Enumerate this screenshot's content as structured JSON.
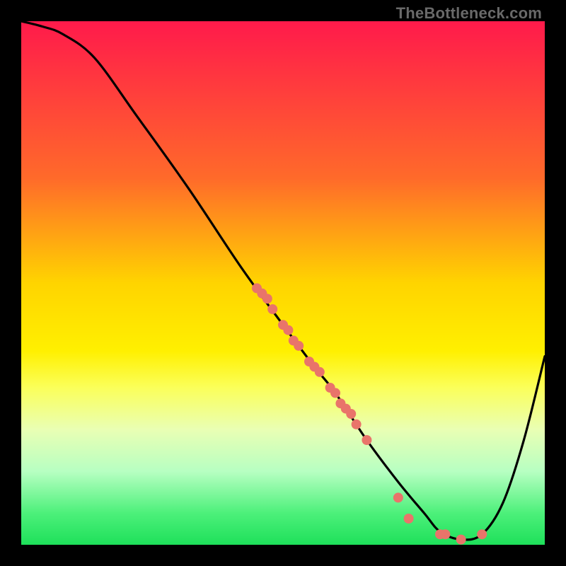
{
  "watermark": "TheBottleneck.com",
  "chart_data": {
    "type": "line",
    "title": "",
    "xlabel": "",
    "ylabel": "",
    "xlim": [
      0,
      100
    ],
    "ylim": [
      0,
      100
    ],
    "gradient": {
      "stops": [
        {
          "offset": 0.0,
          "color": "#ff1a4b"
        },
        {
          "offset": 0.3,
          "color": "#ff6a2a"
        },
        {
          "offset": 0.5,
          "color": "#ffd400"
        },
        {
          "offset": 0.63,
          "color": "#fff000"
        },
        {
          "offset": 0.7,
          "color": "#fbff5a"
        },
        {
          "offset": 0.78,
          "color": "#e9ffb4"
        },
        {
          "offset": 0.86,
          "color": "#b7ffc2"
        },
        {
          "offset": 0.94,
          "color": "#4cf07a"
        },
        {
          "offset": 1.0,
          "color": "#1ee05a"
        }
      ]
    },
    "series": [
      {
        "name": "curve",
        "x": [
          0,
          4,
          8,
          14,
          22,
          32,
          42,
          50,
          56,
          60,
          66,
          72,
          77,
          80,
          84,
          88,
          92,
          96,
          100
        ],
        "y": [
          100,
          99,
          97.5,
          93,
          82,
          68,
          53,
          42,
          34,
          29,
          20,
          12,
          6,
          2.5,
          1,
          2,
          8,
          20,
          36
        ]
      }
    ],
    "scatter": {
      "name": "points",
      "color": "#e9746a",
      "x": [
        45,
        46,
        47,
        48,
        50,
        51,
        52,
        53,
        55,
        56,
        57,
        59,
        60,
        61,
        62,
        63,
        64,
        66,
        72,
        74,
        80,
        81,
        84,
        88
      ],
      "y": [
        49,
        48,
        47,
        45,
        42,
        41,
        39,
        38,
        35,
        34,
        33,
        30,
        29,
        27,
        26,
        25,
        23,
        20,
        9,
        5,
        2,
        2,
        1,
        2
      ]
    }
  }
}
